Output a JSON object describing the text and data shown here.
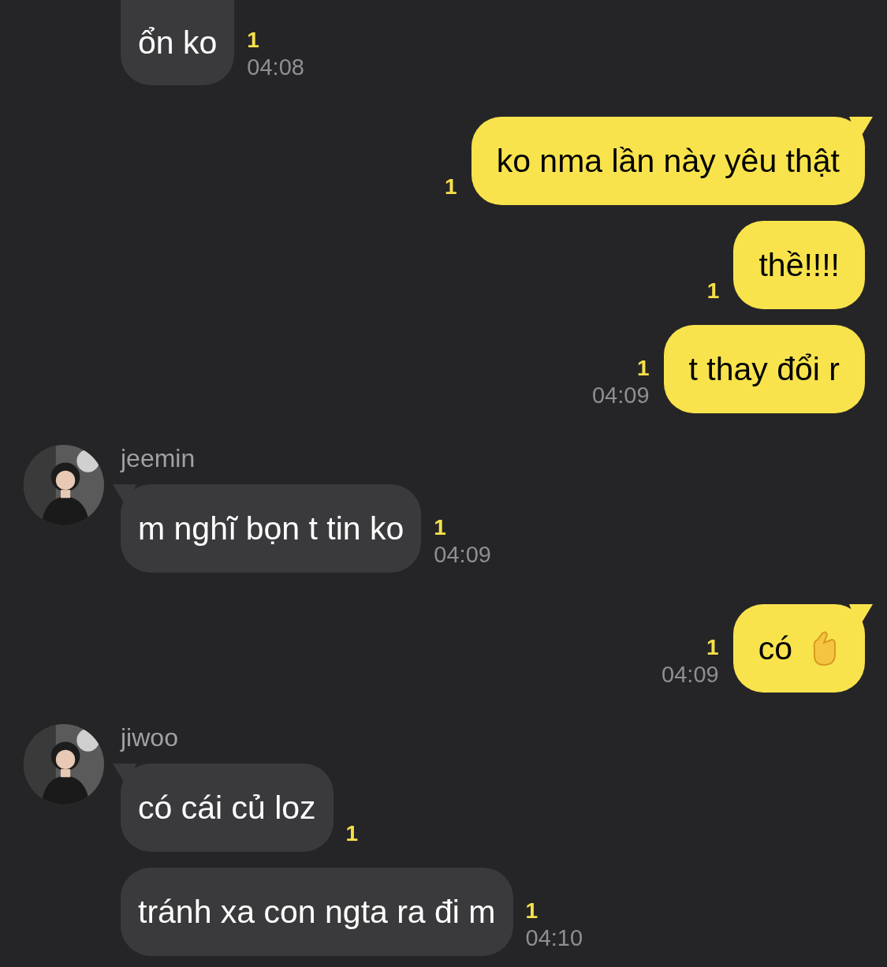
{
  "messages": [
    {
      "kind": "incoming",
      "text": "ổn ko",
      "unread": "1",
      "time": "04:08"
    },
    {
      "kind": "outgoing",
      "text": "ko nma lần này yêu thật",
      "tail": true,
      "unread": "1"
    },
    {
      "kind": "outgoing",
      "text": "thề!!!!",
      "tail": false,
      "unread": "1"
    },
    {
      "kind": "outgoing",
      "text": "t thay đổi r",
      "tail": false,
      "unread": "1",
      "time": "04:09"
    },
    {
      "kind": "incoming",
      "sender": "jeemin",
      "text": "m nghĩ bọn t tin ko",
      "tail": true,
      "unread": "1",
      "time": "04:09"
    },
    {
      "kind": "outgoing",
      "text": "có",
      "emoji": {
        "kind": "hand"
      },
      "tail": true,
      "unread": "1",
      "time": "04:09"
    },
    {
      "kind": "incoming",
      "sender": "jiwoo",
      "text": "có cái củ loz",
      "tail": true,
      "unread": "1"
    },
    {
      "kind": "incoming",
      "text": "tránh xa con ngta ra đi m",
      "tail": false,
      "unread": "1",
      "time": "04:10"
    }
  ]
}
